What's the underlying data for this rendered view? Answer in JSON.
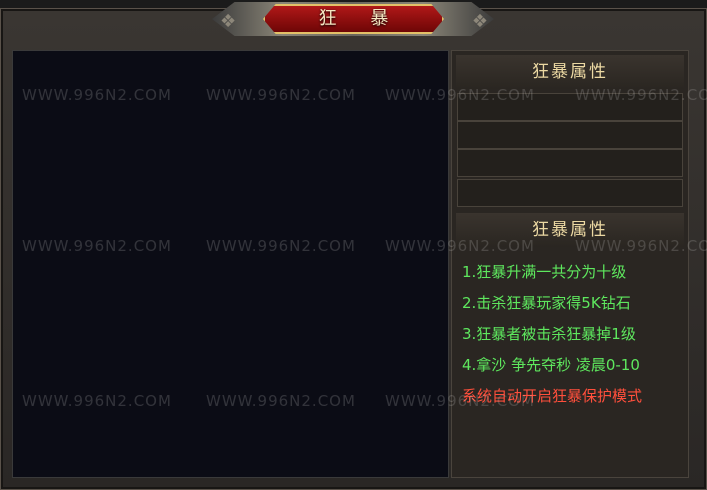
{
  "window": {
    "title": "狂 暴"
  },
  "attributes_panel": {
    "header": "狂暴属性",
    "slots": [
      "",
      "",
      "",
      ""
    ]
  },
  "rules_panel": {
    "header": "狂暴属性",
    "lines": [
      "1.狂暴升满一共分为十级",
      "2.击杀狂暴玩家得5K钻石",
      "3.狂暴者被击杀狂暴掉1级",
      "4.拿沙 争先夺秒 凌晨0-10"
    ],
    "warning": "系统自动开启狂暴保护模式"
  },
  "colors": {
    "rule_text": "#5ee85e",
    "warning_text": "#ff4f3c",
    "header_text": "#ecd9a3",
    "title_plate": "#8b0d0d"
  },
  "watermark": {
    "text": "WWW.996N2.COM"
  }
}
